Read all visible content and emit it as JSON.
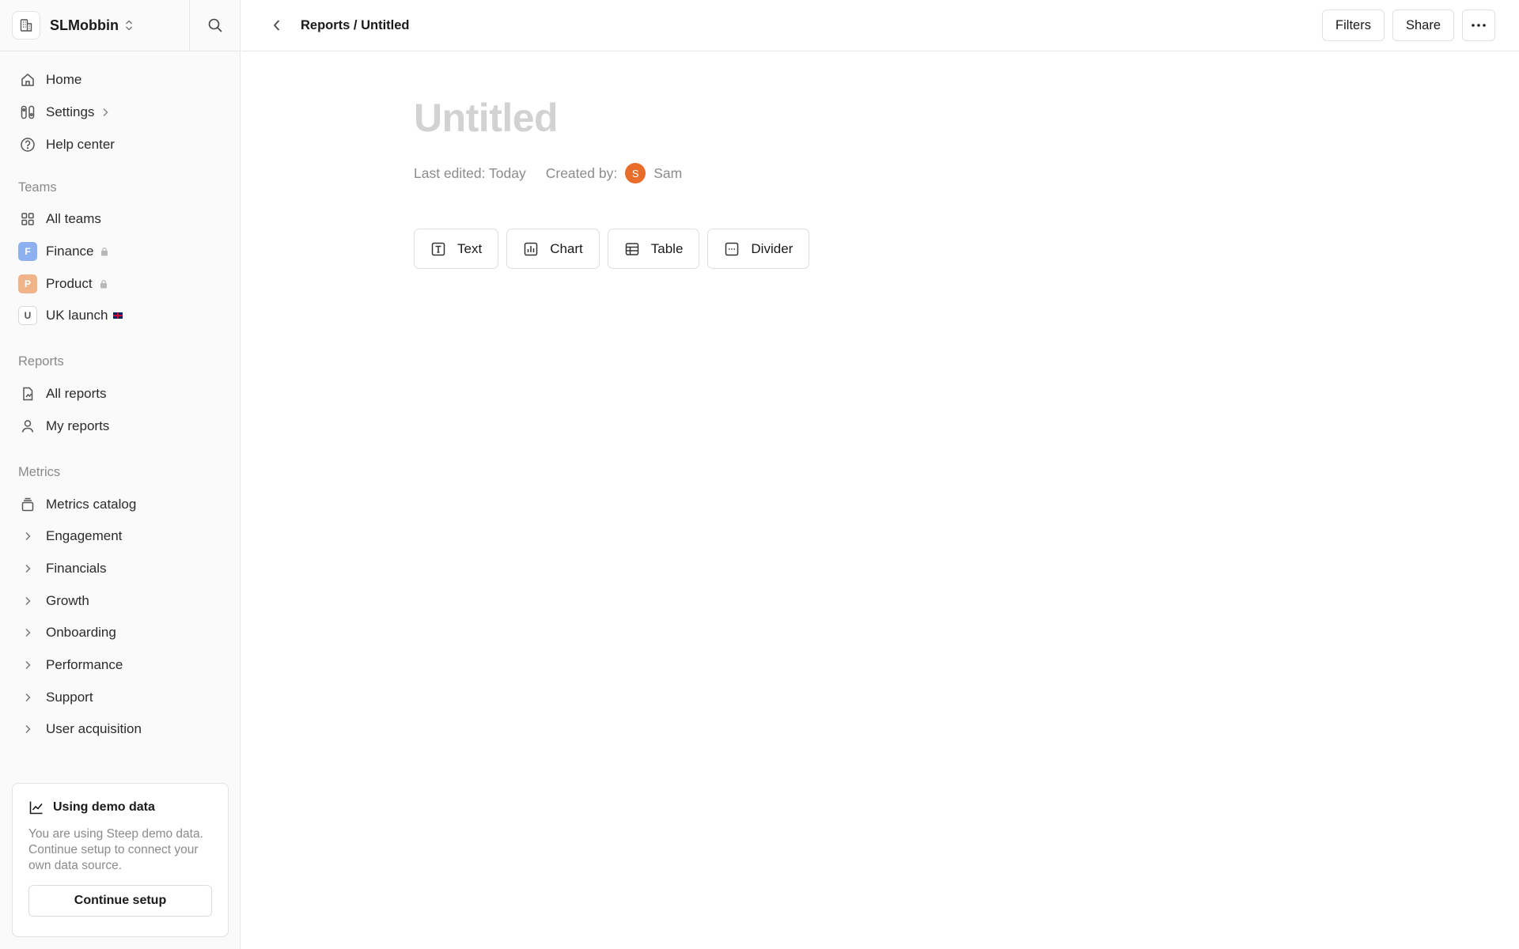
{
  "workspace": {
    "name": "SLMobbin"
  },
  "topbar": {
    "breadcrumb": "Reports / Untitled",
    "filters_label": "Filters",
    "share_label": "Share"
  },
  "sidebar": {
    "primary": [
      {
        "label": "Home",
        "icon": "home-icon"
      },
      {
        "label": "Settings",
        "icon": "settings-icon"
      },
      {
        "label": "Help center",
        "icon": "help-circle-icon"
      }
    ],
    "teams_title": "Teams",
    "teams": [
      {
        "label": "All teams",
        "icon": "grid-icon"
      },
      {
        "label": "Finance",
        "badge": "F",
        "badge_color": "#8eb0f0"
      },
      {
        "label": "Product",
        "badge": "P",
        "badge_color": "#f0b48a"
      },
      {
        "label": "UK launch",
        "badge": "U"
      }
    ],
    "reports_title": "Reports",
    "reports": [
      {
        "label": "All reports",
        "icon": "report-icon"
      },
      {
        "label": "My reports",
        "icon": "user-icon"
      }
    ],
    "metrics_title": "Metrics",
    "metrics_catalog": "Metrics catalog",
    "metrics": [
      "Engagement",
      "Financials",
      "Growth",
      "Onboarding",
      "Performance",
      "Support",
      "User acquisition"
    ]
  },
  "demo": {
    "title": "Using demo data",
    "text": "You are using Steep demo data. Continue setup to connect your own data source.",
    "button": "Continue setup"
  },
  "document": {
    "title": "Untitled",
    "last_edited": "Last edited: Today",
    "created_by_label": "Created by:",
    "creator_initial": "S",
    "creator_name": "Sam"
  },
  "blocks": [
    {
      "label": "Text",
      "icon": "text-icon"
    },
    {
      "label": "Chart",
      "icon": "bar-chart-icon"
    },
    {
      "label": "Table",
      "icon": "table-icon"
    },
    {
      "label": "Divider",
      "icon": "divider-icon"
    }
  ]
}
